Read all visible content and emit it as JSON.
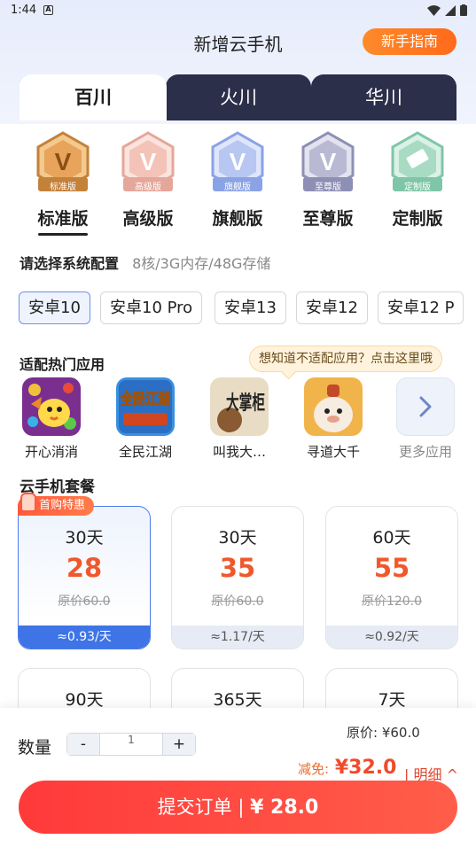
{
  "status_bar": {
    "time": "1:44",
    "notif": "A"
  },
  "header": {
    "title": "新增云手机",
    "guide_button": "新手指南"
  },
  "tabs": [
    {
      "label": "百川",
      "active": true
    },
    {
      "label": "火川",
      "active": false
    },
    {
      "label": "华川",
      "active": false
    }
  ],
  "tiers": [
    {
      "label": "标准版",
      "badge": "标准版",
      "color": "#c4813a",
      "selected": true
    },
    {
      "label": "高级版",
      "badge": "高级版",
      "color": "#e4a79a",
      "selected": false
    },
    {
      "label": "旗舰版",
      "badge": "旗舰版",
      "color": "#8aa3e6",
      "selected": false
    },
    {
      "label": "至尊版",
      "badge": "至尊版",
      "color": "#8e8fb4",
      "selected": false
    },
    {
      "label": "定制版",
      "badge": "定制版",
      "color": "#7fc6a8",
      "selected": false
    }
  ],
  "config": {
    "title": "请选择系统配置",
    "spec": "8核/3G内存/48G存储"
  },
  "os_options": [
    {
      "label": "安卓10",
      "selected": true
    },
    {
      "label": "安卓10 Pro",
      "selected": false
    },
    {
      "label": "安卓13",
      "selected": false
    },
    {
      "label": "安卓12",
      "selected": false
    },
    {
      "label": "安卓12 P",
      "selected": false
    }
  ],
  "apps": {
    "title": "适配热门应用",
    "tooltip": "想知道不适配应用？点击这里哦",
    "items": [
      {
        "name": "开心消消"
      },
      {
        "name": "全民江湖"
      },
      {
        "name": "叫我大…"
      },
      {
        "name": "寻道大千"
      }
    ],
    "icon_texts": {
      "jianghu": "全民江湖",
      "zhanggui": "大掌柜"
    },
    "more_label": "更多应用"
  },
  "plans": {
    "title": "云手机套餐",
    "promo_tag": "首购特惠",
    "items": [
      {
        "days": "30天",
        "price": "28",
        "original": "原价60.0",
        "per_day": "≈0.93/天",
        "selected": true
      },
      {
        "days": "30天",
        "price": "35",
        "original": "原价60.0",
        "per_day": "≈1.17/天",
        "selected": false
      },
      {
        "days": "60天",
        "price": "55",
        "original": "原价120.0",
        "per_day": "≈0.92/天",
        "selected": false
      },
      {
        "days": "90天"
      },
      {
        "days": "365天"
      },
      {
        "days": "7天"
      }
    ]
  },
  "order": {
    "quantity_label": "数量",
    "minus": "-",
    "quantity": "1",
    "plus": "+",
    "original_price": "原价: ¥60.0",
    "discount_label": "减免:",
    "discount_amount": "¥32.0",
    "detail_link": "| 明细 ^",
    "submit_label": "提交订单 | ",
    "submit_price": "¥ 28.0"
  },
  "colors": {
    "accent_orange": "#ff7a22",
    "tab_dark": "#2b2f49",
    "price_red": "#f0582b",
    "selected_blue": "#3e74e6",
    "submit_red": "#ff3a3a"
  }
}
